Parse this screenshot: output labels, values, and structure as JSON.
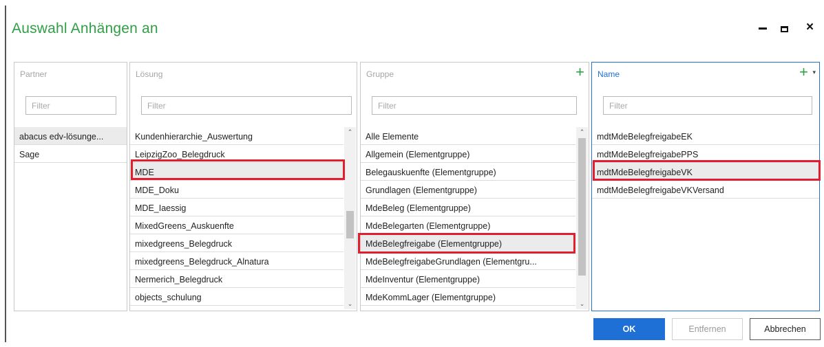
{
  "dialog": {
    "title": "Auswahl Anhängen an",
    "accent": "#2f9e44",
    "selection_color": "#1e6fd6",
    "highlight_color": "#e01e2d"
  },
  "window_controls": {
    "minimize": "minimize-icon",
    "maximize": "maximize-icon",
    "close": "×"
  },
  "columns": {
    "partner": {
      "header": "Partner",
      "filter_placeholder": "Filter",
      "items": [
        "abacus edv-lösunge...",
        "Sage"
      ]
    },
    "loesung": {
      "header": "Lösung",
      "filter_placeholder": "Filter",
      "items": [
        "Kundenhierarchie_Auswertung",
        "LeipzigZoo_Belegdruck",
        "MDE",
        "MDE_Doku",
        "MDE_Iaessig",
        "MixedGreens_Auskuenfte",
        "mixedgreens_Belegdruck",
        "mixedgreens_Belegdruck_Alnatura",
        "Nermerich_Belegdruck",
        "objects_schulung"
      ],
      "highlighted": "MDE"
    },
    "gruppe": {
      "header": "Gruppe",
      "filter_placeholder": "Filter",
      "add_icon": "+",
      "items": [
        "Alle Elemente",
        "Allgemein (Elementgruppe)",
        "Belegauskuenfte (Elementgruppe)",
        "Grundlagen (Elementgruppe)",
        "MdeBeleg (Elementgruppe)",
        "MdeBelegarten (Elementgruppe)",
        "MdeBelegfreigabe (Elementgruppe)",
        "MdeBelegfreigabeGrundlagen (Elementgru...",
        "MdeInventur (Elementgruppe)",
        "MdeKommLager (Elementgruppe)"
      ],
      "highlighted": "MdeBelegfreigabe (Elementgruppe)"
    },
    "name": {
      "header": "Name",
      "filter_placeholder": "Filter",
      "add_icon": "+",
      "caret_icon": "▾",
      "items": [
        "mdtMdeBelegfreigabeEK",
        "mdtMdeBelegfreigabePPS",
        "mdtMdeBelegfreigabeVK",
        "mdtMdeBelegfreigabeVKVersand"
      ],
      "highlighted": "mdtMdeBelegfreigabeVK"
    }
  },
  "scroll": {
    "up": "⌃",
    "down": "⌄"
  },
  "buttons": {
    "ok": "OK",
    "remove": "Entfernen",
    "cancel": "Abbrechen"
  }
}
